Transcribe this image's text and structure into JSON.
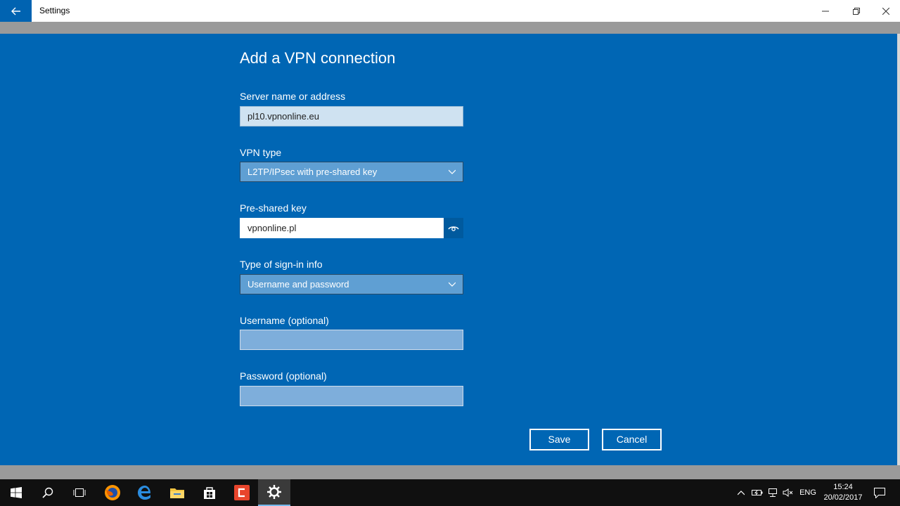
{
  "window": {
    "title": "Settings"
  },
  "dialog": {
    "title": "Add a VPN connection",
    "server": {
      "label": "Server name or address",
      "value": "pl10.vpnonline.eu"
    },
    "vpn_type": {
      "label": "VPN type",
      "value": "L2TP/IPsec with pre-shared key"
    },
    "psk": {
      "label": "Pre-shared key",
      "value": "vpnonline.pl"
    },
    "signin": {
      "label": "Type of sign-in info",
      "value": "Username and password"
    },
    "username": {
      "label": "Username (optional)",
      "value": ""
    },
    "password": {
      "label": "Password (optional)",
      "value": ""
    },
    "save_label": "Save",
    "cancel_label": "Cancel"
  },
  "taskbar": {
    "items": [
      "start-icon",
      "search-icon",
      "task-view-icon",
      "firefox-icon",
      "edge-icon",
      "file-explorer-icon",
      "store-icon",
      "screen-recorder-icon",
      "settings-icon"
    ],
    "language": "ENG",
    "time": "15:24",
    "date": "20/02/2017"
  },
  "colors": {
    "accent": "#0066b4",
    "titlebar_back": "#0063b1"
  }
}
